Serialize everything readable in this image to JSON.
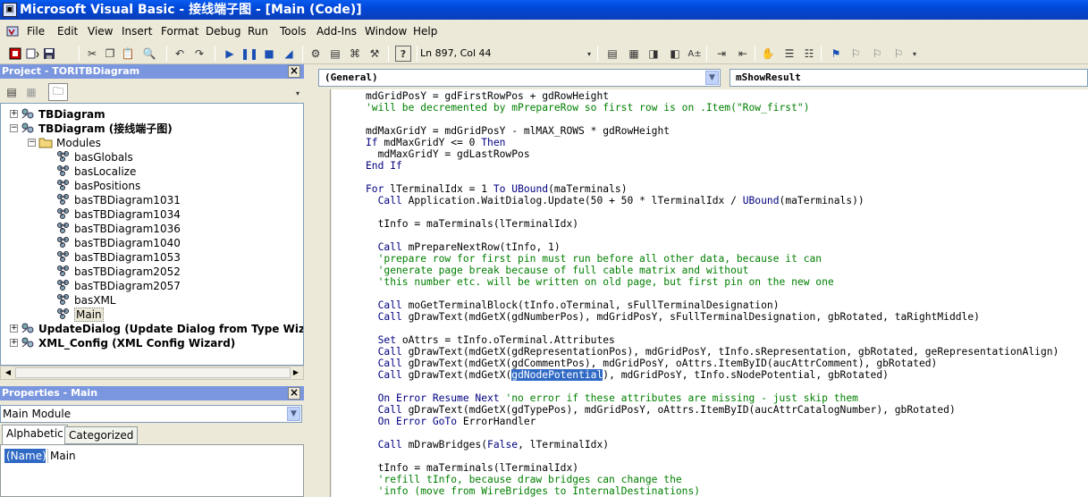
{
  "window": {
    "title": "Microsoft Visual Basic - 接线端子图 - [Main (Code)]"
  },
  "menu": [
    "File",
    "Edit",
    "View",
    "Insert",
    "Format",
    "Debug",
    "Run",
    "Tools",
    "Add-Ins",
    "Window",
    "Help"
  ],
  "toolbar": {
    "position": "Ln 897, Col 44"
  },
  "project": {
    "header": "Project - TORITBDiagram",
    "tree": [
      {
        "label": "TBDiagram",
        "level": 0,
        "expanded": false,
        "icon": "vba-project-icon",
        "bold": true
      },
      {
        "label": "TBDiagram (接线端子图)",
        "level": 0,
        "expanded": true,
        "icon": "vba-project-icon",
        "bold": true
      },
      {
        "label": "Modules",
        "level": 1,
        "expanded": true,
        "icon": "folder-icon",
        "bold": false
      },
      {
        "label": "basGlobals",
        "level": 2,
        "icon": "module-icon"
      },
      {
        "label": "basLocalize",
        "level": 2,
        "icon": "module-icon"
      },
      {
        "label": "basPositions",
        "level": 2,
        "icon": "module-icon"
      },
      {
        "label": "basTBDiagram1031",
        "level": 2,
        "icon": "module-icon"
      },
      {
        "label": "basTBDiagram1034",
        "level": 2,
        "icon": "module-icon"
      },
      {
        "label": "basTBDiagram1036",
        "level": 2,
        "icon": "module-icon"
      },
      {
        "label": "basTBDiagram1040",
        "level": 2,
        "icon": "module-icon"
      },
      {
        "label": "basTBDiagram1053",
        "level": 2,
        "icon": "module-icon"
      },
      {
        "label": "basTBDiagram2052",
        "level": 2,
        "icon": "module-icon"
      },
      {
        "label": "basTBDiagram2057",
        "level": 2,
        "icon": "module-icon"
      },
      {
        "label": "basXML",
        "level": 2,
        "icon": "module-icon"
      },
      {
        "label": "Main",
        "level": 2,
        "icon": "module-icon",
        "selected": true
      },
      {
        "label": "UpdateDialog (Update Dialog from Type Wizard)",
        "level": 0,
        "expanded": false,
        "icon": "vba-project-icon",
        "bold": true
      },
      {
        "label": "XML_Config (XML Config Wizard)",
        "level": 0,
        "expanded": false,
        "icon": "vba-project-icon",
        "bold": true
      }
    ]
  },
  "properties": {
    "header": "Properties - Main",
    "object_name": "Main",
    "object_type": "Module",
    "tabs": [
      "Alphabetic",
      "Categorized"
    ],
    "active_tab": "Alphabetic",
    "row_name": "(Name)",
    "row_value": "Main"
  },
  "code": {
    "object_combo": "(General)",
    "proc_combo": "mShowResult",
    "lines": [
      [
        {
          "t": "mdGridPosY = gdFirstRowPos + gdRowHeight",
          "c": "n"
        }
      ],
      [
        {
          "t": "'will be decremented by mPrepareRow so first row is on .Item(\"Row_first\")",
          "c": "c"
        }
      ],
      [],
      [
        {
          "t": "mdMaxGridY = mdGridPosY - mlMAX_ROWS * gdRowHeight",
          "c": "n"
        }
      ],
      [
        {
          "t": "If",
          "c": "k"
        },
        {
          "t": " mdMaxGridY <= 0 ",
          "c": "n"
        },
        {
          "t": "Then",
          "c": "k"
        }
      ],
      [
        {
          "t": "  mdMaxGridY = gdLastRowPos",
          "c": "n"
        }
      ],
      [
        {
          "t": "End If",
          "c": "k"
        }
      ],
      [],
      [
        {
          "t": "For",
          "c": "k"
        },
        {
          "t": " lTerminalIdx = 1 ",
          "c": "n"
        },
        {
          "t": "To",
          "c": "k"
        },
        {
          "t": " ",
          "c": "n"
        },
        {
          "t": "UBound",
          "c": "k"
        },
        {
          "t": "(maTerminals)",
          "c": "n"
        }
      ],
      [
        {
          "t": "  ",
          "c": "n"
        },
        {
          "t": "Call",
          "c": "k"
        },
        {
          "t": " Application.WaitDialog.Update(50 + 50 * lTerminalIdx / ",
          "c": "n"
        },
        {
          "t": "UBound",
          "c": "k"
        },
        {
          "t": "(maTerminals))",
          "c": "n"
        }
      ],
      [],
      [
        {
          "t": "  tInfo = maTerminals(lTerminalIdx)",
          "c": "n"
        }
      ],
      [],
      [
        {
          "t": "  ",
          "c": "n"
        },
        {
          "t": "Call",
          "c": "k"
        },
        {
          "t": " mPrepareNextRow(tInfo, 1)",
          "c": "n"
        }
      ],
      [
        {
          "t": "  'prepare row for first pin must run before all other data, because it can",
          "c": "c"
        }
      ],
      [
        {
          "t": "  'generate page break because of full cable matrix and without",
          "c": "c"
        }
      ],
      [
        {
          "t": "  'this number etc. will be written on old page, but first pin on the new one",
          "c": "c"
        }
      ],
      [],
      [
        {
          "t": "  ",
          "c": "n"
        },
        {
          "t": "Call",
          "c": "k"
        },
        {
          "t": " moGetTerminalBlock(tInfo.oTerminal, sFullTerminalDesignation)",
          "c": "n"
        }
      ],
      [
        {
          "t": "  ",
          "c": "n"
        },
        {
          "t": "Call",
          "c": "k"
        },
        {
          "t": " gDrawText(mdGetX(gdNumberPos), mdGridPosY, sFullTerminalDesignation, gbRotated, taRightMiddle)",
          "c": "n"
        }
      ],
      [],
      [
        {
          "t": "  ",
          "c": "n"
        },
        {
          "t": "Set",
          "c": "k"
        },
        {
          "t": " oAttrs = tInfo.oTerminal.Attributes",
          "c": "n"
        }
      ],
      [
        {
          "t": "  ",
          "c": "n"
        },
        {
          "t": "Call",
          "c": "k"
        },
        {
          "t": " gDrawText(mdGetX(gdRepresentationPos), mdGridPosY, tInfo.sRepresentation, gbRotated, geRepresentationAlign)",
          "c": "n"
        }
      ],
      [
        {
          "t": "  ",
          "c": "n"
        },
        {
          "t": "Call",
          "c": "k"
        },
        {
          "t": " gDrawText(mdGetX(gdCommentPos), mdGridPosY, oAttrs.ItemByID(aucAttrComment), gbRotated)",
          "c": "n"
        }
      ],
      [
        {
          "t": "  ",
          "c": "n"
        },
        {
          "t": "Call",
          "c": "k"
        },
        {
          "t": " gDrawText(mdGetX(",
          "c": "n"
        },
        {
          "t": "gdNodePotential",
          "c": "h"
        },
        {
          "t": "), mdGridPosY, tInfo.sNodePotential, gbRotated)",
          "c": "n"
        }
      ],
      [],
      [
        {
          "t": "  ",
          "c": "n"
        },
        {
          "t": "On Error Resume Next",
          "c": "k"
        },
        {
          "t": " 'no error if these attributes are missing - just skip them",
          "c": "c"
        }
      ],
      [
        {
          "t": "  ",
          "c": "n"
        },
        {
          "t": "Call",
          "c": "k"
        },
        {
          "t": " gDrawText(mdGetX(gdTypePos), mdGridPosY, oAttrs.ItemByID(aucAttrCatalogNumber), gbRotated)",
          "c": "n"
        }
      ],
      [
        {
          "t": "  ",
          "c": "n"
        },
        {
          "t": "On Error GoTo",
          "c": "k"
        },
        {
          "t": " ErrorHandler",
          "c": "n"
        }
      ],
      [],
      [
        {
          "t": "  ",
          "c": "n"
        },
        {
          "t": "Call",
          "c": "k"
        },
        {
          "t": " mDrawBridges(",
          "c": "n"
        },
        {
          "t": "False",
          "c": "k"
        },
        {
          "t": ", lTerminalIdx)",
          "c": "n"
        }
      ],
      [],
      [
        {
          "t": "  tInfo = maTerminals(lTerminalIdx)",
          "c": "n"
        }
      ],
      [
        {
          "t": "  'refill tInfo, because draw bridges can change the",
          "c": "c"
        }
      ],
      [
        {
          "t": "  'info (move from WireBridges to InternalDestinations)",
          "c": "c"
        }
      ]
    ]
  }
}
